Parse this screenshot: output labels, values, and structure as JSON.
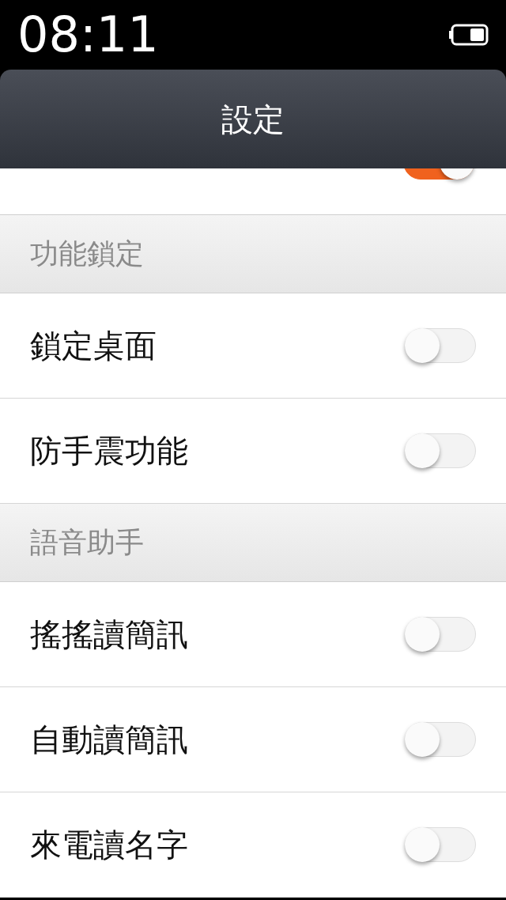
{
  "status_bar": {
    "time": "08:11"
  },
  "header": {
    "title": "設定"
  },
  "cut_row": {
    "on": true
  },
  "sections": [
    {
      "title": "功能鎖定",
      "items": [
        {
          "label": "鎖定桌面",
          "on": false
        },
        {
          "label": "防手震功能",
          "on": false
        }
      ]
    },
    {
      "title": "語音助手",
      "items": [
        {
          "label": "搖搖讀簡訊",
          "on": false
        },
        {
          "label": "自動讀簡訊",
          "on": false
        },
        {
          "label": "來電讀名字",
          "on": false
        }
      ]
    }
  ]
}
